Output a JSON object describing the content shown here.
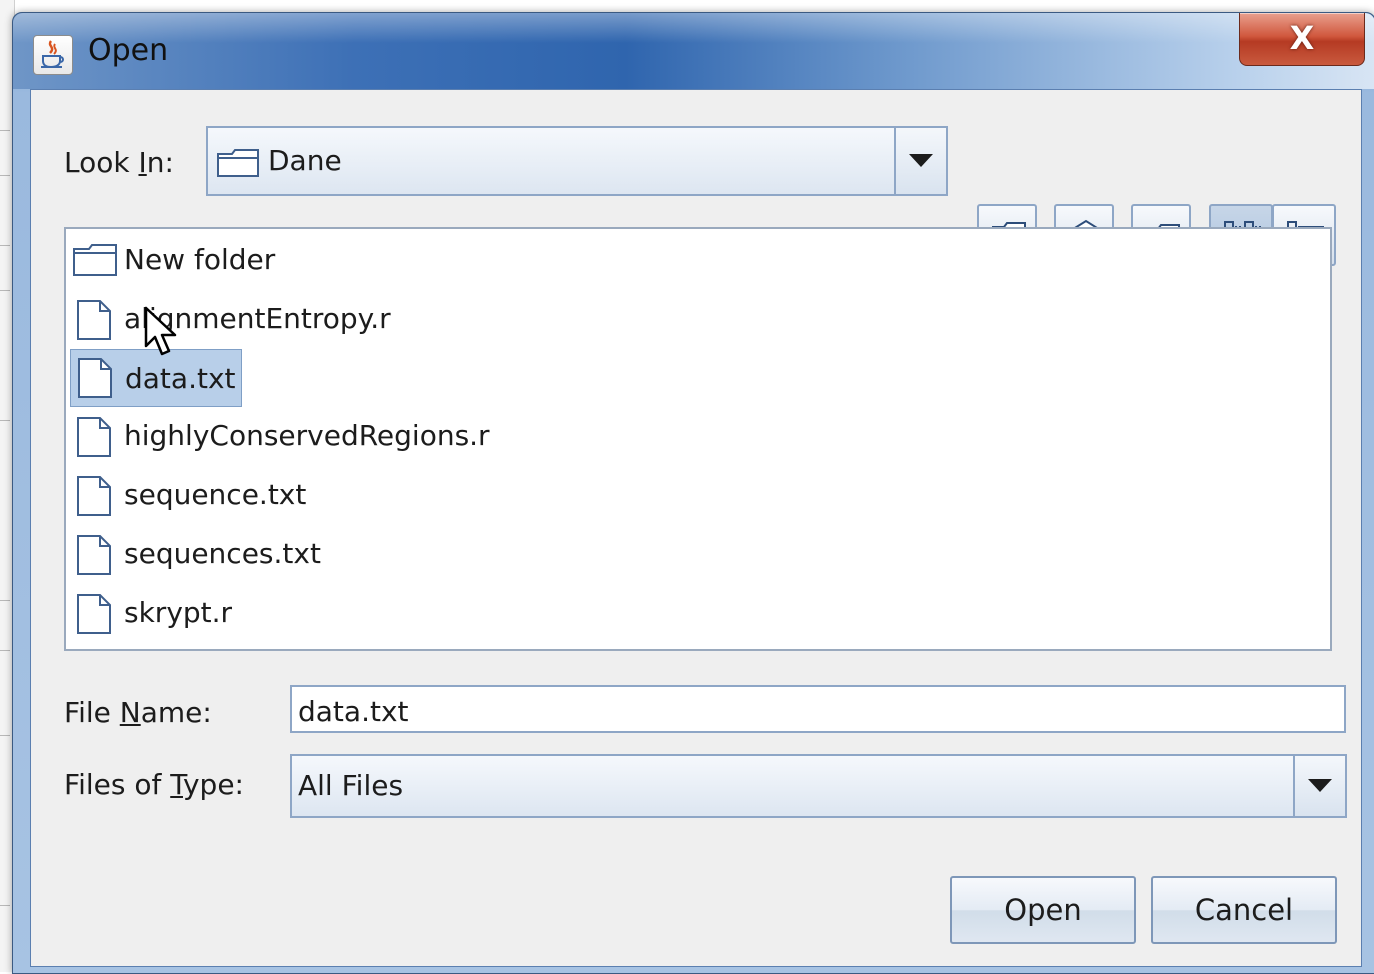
{
  "dialog": {
    "title": "Open",
    "close_label": "X"
  },
  "look_in": {
    "label_pre": "Look ",
    "label_mnemonic": "I",
    "label_post": "n:",
    "value": "Dane"
  },
  "toolbar": {
    "buttons": [
      "up-one-level-icon",
      "home-icon",
      "new-folder-icon",
      "list-view-icon",
      "details-view-icon"
    ]
  },
  "files": [
    {
      "name": "New folder",
      "type": "folder"
    },
    {
      "name": "alignmentEntropy.r",
      "type": "file"
    },
    {
      "name": "data.txt",
      "type": "file",
      "selected": true
    },
    {
      "name": "highlyConservedRegions.r",
      "type": "file"
    },
    {
      "name": "sequence.txt",
      "type": "file"
    },
    {
      "name": "sequences.txt",
      "type": "file"
    },
    {
      "name": "skrypt.r",
      "type": "file"
    }
  ],
  "file_name": {
    "label_pre": "File ",
    "label_mnemonic": "N",
    "label_post": "ame:",
    "value": "data.txt"
  },
  "files_of_type": {
    "label_pre": "Files of ",
    "label_mnemonic": "T",
    "label_post": "ype:",
    "value": "All Files"
  },
  "buttons": {
    "open": "Open",
    "cancel": "Cancel"
  },
  "colors": {
    "selection": "#b8cfe9",
    "title_blue": "#2f65ae",
    "close_red": "#c9462c"
  }
}
